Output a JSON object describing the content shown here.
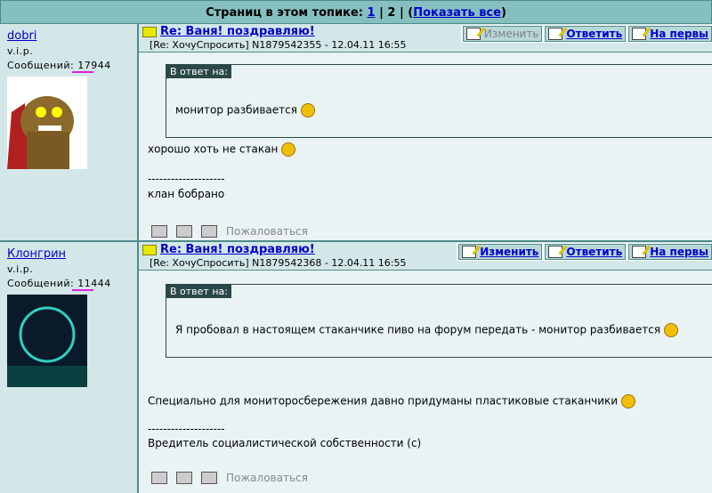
{
  "pager": {
    "label": "Страниц в этом топике:",
    "page1": "1",
    "sep": "|",
    "page2": "2",
    "sep2": "|",
    "open": "(",
    "show_all": "Показать все",
    "close": ")"
  },
  "buttons": {
    "edit": "Изменить",
    "reply": "Ответить",
    "first": "На первы"
  },
  "quote_label": "В ответ на:",
  "complain": "Пожаловаться",
  "posts": [
    {
      "author": "dobri",
      "rank": "v.i.p.",
      "messages_label": "Сообщений:",
      "messages": "17944",
      "title": "Re: Ваня! поздравляю!",
      "meta": "[Re: ХочуСпросить]  N1879542355 - 12.04.11 16:55",
      "quote": "монитор разбивается",
      "text": "хорошо хоть не стакан",
      "sig_line": "--------------------",
      "signature": "клан бобрано",
      "edit_enabled": false
    },
    {
      "author": "Клонгрин",
      "rank": "v.i.p.",
      "messages_label": "Сообщений:",
      "messages": "11444",
      "title": "Re: Ваня! поздравляю!",
      "meta": "[Re: ХочуСпросить]  N1879542368 - 12.04.11 16:55",
      "quote": "Я пробовал в настоящем стаканчике пиво на форум передать - монитор разбивается",
      "text": "Специально для мониторосбережения давно придуманы пластиковые стаканчики",
      "sig_line": "--------------------",
      "signature": "Вредитель социалистической собственности (с)",
      "edit_enabled": true
    }
  ]
}
